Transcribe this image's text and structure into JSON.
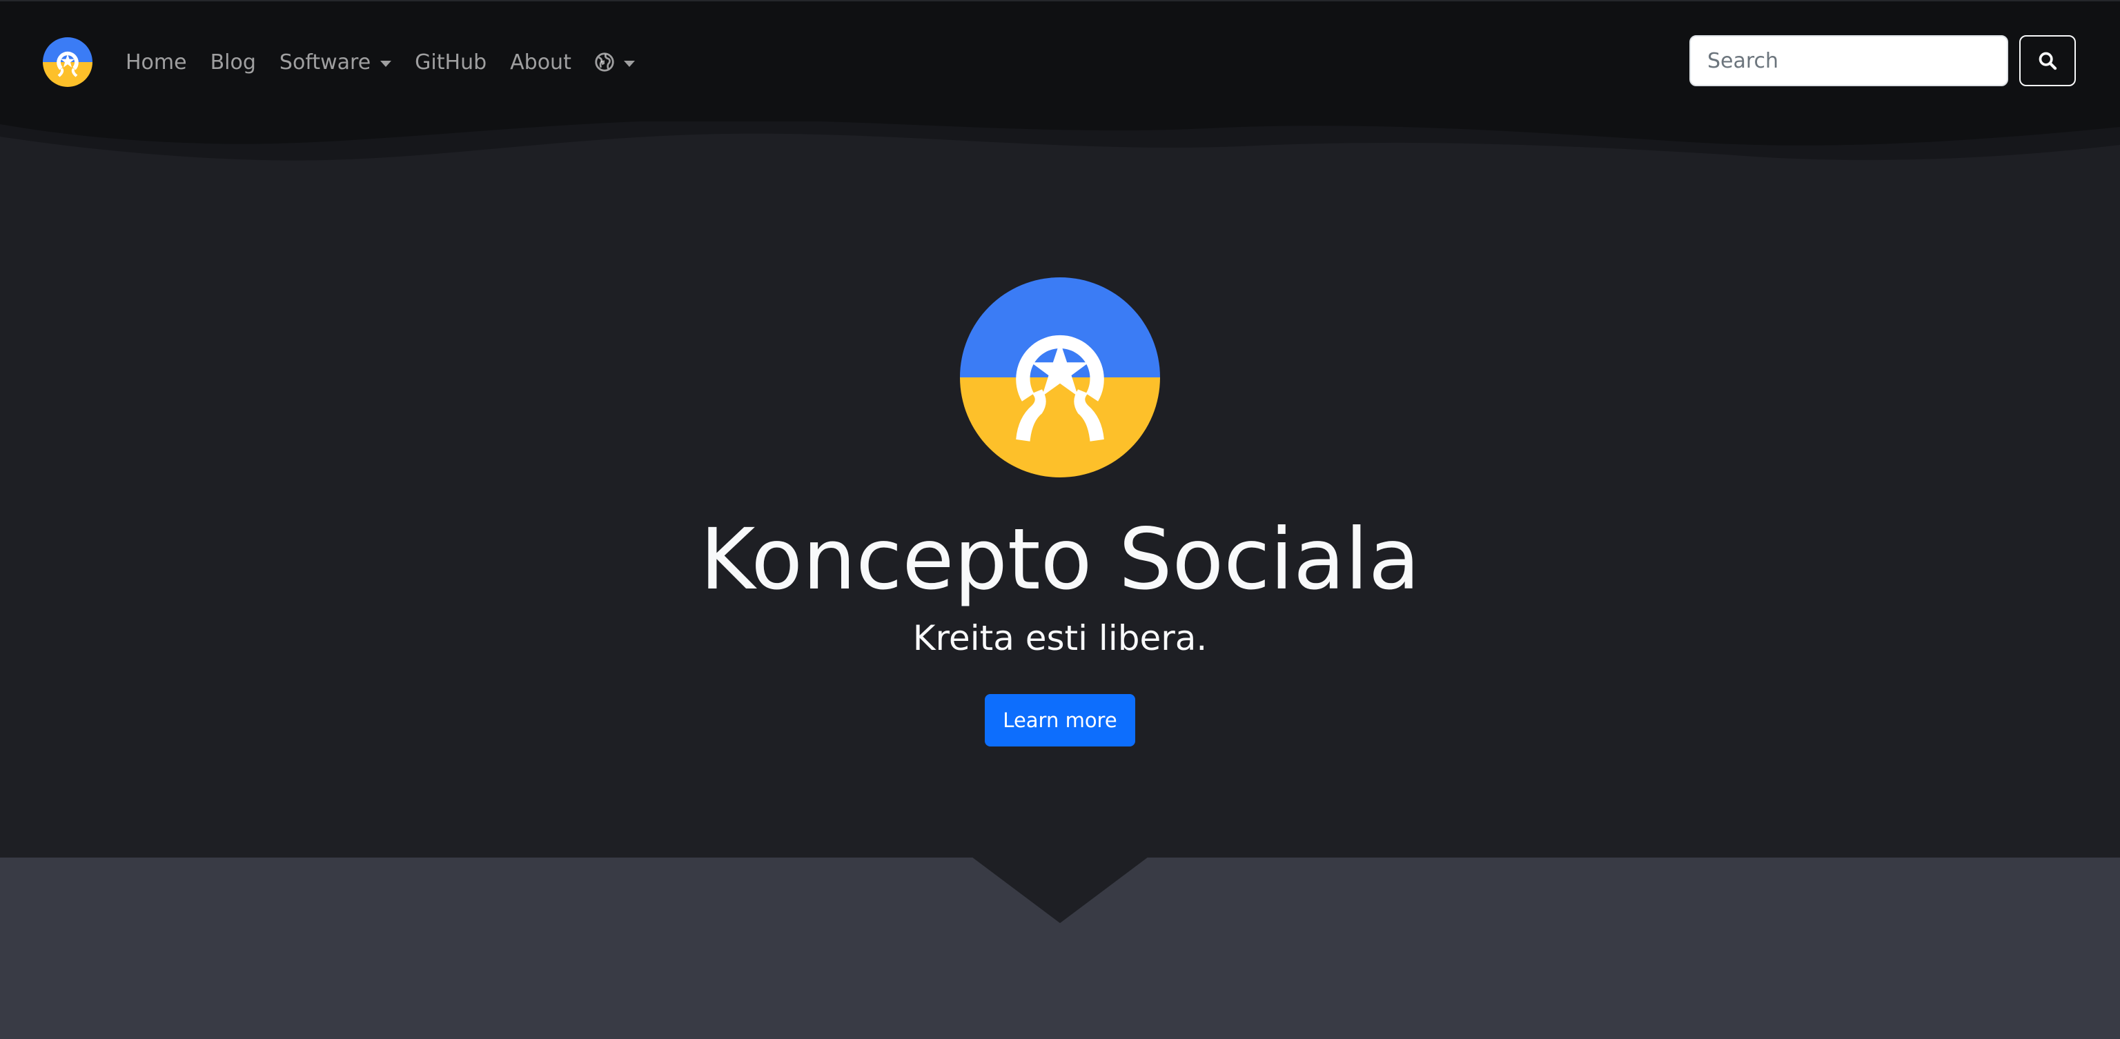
{
  "nav": {
    "brand_icon": "koncepto-logo-icon",
    "links": [
      {
        "label": "Home"
      },
      {
        "label": "Blog"
      },
      {
        "label": "Software",
        "dropdown": true
      },
      {
        "label": "GitHub"
      },
      {
        "label": "About"
      }
    ],
    "language_icon": "globe-icon",
    "search": {
      "placeholder": "Search",
      "value": "",
      "button_icon": "search-icon"
    }
  },
  "hero": {
    "logo_icon": "koncepto-logo-icon",
    "title": "Koncepto Sociala",
    "subtitle": "Kreita esti libera.",
    "cta_label": "Learn more"
  },
  "colors": {
    "navbar_bg": "#0f1012",
    "hero_bg": "#1e1f24",
    "section_bg": "#393b45",
    "accent": "#0d6efd",
    "logo_blue": "#3b7cf5",
    "logo_yellow": "#fdc02a"
  }
}
